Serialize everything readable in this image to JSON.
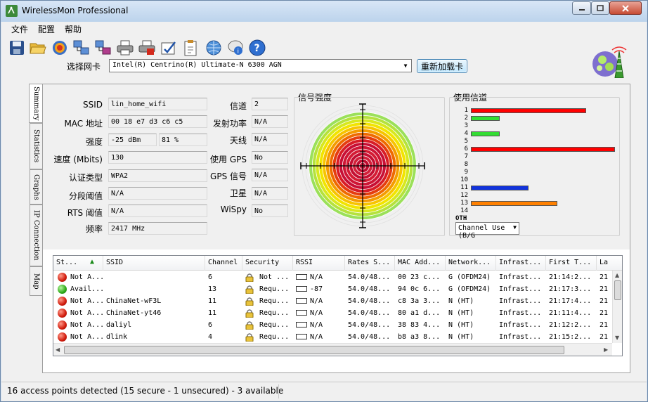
{
  "window": {
    "title": "WirelessMon Professional"
  },
  "menu": [
    "文件",
    "配置",
    "帮助"
  ],
  "toolbar": [
    "save-icon",
    "open-folder-icon",
    "record-icon",
    "network-connect-icon",
    "network-disconnect-icon",
    "print-icon",
    "print-stop-icon",
    "checklist-icon",
    "clipboard-icon",
    "globe-network-icon",
    "chat-info-icon",
    "help-icon"
  ],
  "adapter": {
    "label": "选择网卡",
    "value": "Intel(R) Centrino(R) Ultimate-N 6300 AGN",
    "reload_label": "重新加载卡"
  },
  "tabs": [
    "Summary",
    "Statistics",
    "Graphs",
    "IP Connection",
    "Map"
  ],
  "summary": {
    "ssid_label": "SSID",
    "ssid": "lin_home_wifi",
    "mac_label": "MAC 地址",
    "mac": "00 18 e7 d3 c6 c5",
    "strength_label": "强度",
    "strength_dbm": "-25 dBm",
    "strength_pct": "81 %",
    "speed_label": "速度 (Mbits)",
    "speed": "130",
    "auth_label": "认证类型",
    "auth": "WPA2",
    "frag_label": "分段阈值",
    "frag": "N/A",
    "rts_label": "RTS 阈值",
    "rts": "N/A",
    "freq_label": "频率",
    "freq": "2417 MHz",
    "channel_label": "信道",
    "channel": "2",
    "txpower_label": "发射功率",
    "txpower": "N/A",
    "antenna_label": "天线",
    "antenna": "N/A",
    "gps_use_label": "使用 GPS",
    "gps_use": "No",
    "gps_signal_label": "GPS 信号",
    "gps_signal": "N/A",
    "satellite_label": "卫星",
    "satellite": "N/A",
    "wispy_label": "WiSpy",
    "wispy": "No"
  },
  "signal": {
    "title": "信号强度",
    "rings": [
      "#f0f0f0",
      "#f0f0f0",
      "#9be05a",
      "#b5e23c",
      "#d7e81e",
      "#f2e400",
      "#f7c400",
      "#f49c00",
      "#ee6a00",
      "#e53d0f",
      "#d81c26",
      "#c70f35",
      "#ce1635",
      "#d41c34",
      "#c30f32",
      "#d2203a",
      "#bf0d30",
      "#c8193a"
    ]
  },
  "channel_use": {
    "title": "使用信道",
    "channels": [
      "1",
      "2",
      "3",
      "4",
      "5",
      "6",
      "7",
      "8",
      "9",
      "10",
      "11",
      "12",
      "13",
      "14",
      "OTH"
    ],
    "values": [
      16,
      4,
      0,
      4,
      0,
      20,
      0,
      0,
      0,
      0,
      8,
      0,
      12,
      0,
      0
    ],
    "max": 20,
    "colors": [
      "#ff0000",
      "#33dd33",
      "#ffffff",
      "#33dd33",
      "#ffffff",
      "#ff0000",
      "#ffffff",
      "#ffffff",
      "#ffffff",
      "#ffffff",
      "#1133dd",
      "#ffffff",
      "#ff8000",
      "#ffffff",
      "#ffffff"
    ],
    "select_value": "Channel Use (B/G"
  },
  "table": {
    "headers": [
      "St...",
      "SSID",
      "Channel",
      "Security",
      "RSSI",
      "Rates S...",
      "MAC Add...",
      "Network...",
      "Infrast...",
      "First T...",
      "La"
    ],
    "rows": [
      {
        "status": "red",
        "st": "Not A...",
        "ssid": "",
        "channel": "6",
        "security": "Not ...",
        "rssi": "N/A",
        "rates": "54.0/48...",
        "mac": "00 23 c...",
        "network": "G (OFDM24)",
        "infra": "Infrast...",
        "first": "21:14:2...",
        "last": "21"
      },
      {
        "status": "green",
        "st": "Avail...",
        "ssid": "",
        "channel": "13",
        "security": "Requ...",
        "rssi": "-87",
        "rates": "54.0/48...",
        "mac": "94 0c 6...",
        "network": "G (OFDM24)",
        "infra": "Infrast...",
        "first": "21:17:3...",
        "last": "21"
      },
      {
        "status": "red",
        "st": "Not A...",
        "ssid": "ChinaNet-wF3L",
        "channel": "11",
        "security": "Requ...",
        "rssi": "N/A",
        "rates": "54.0/48...",
        "mac": "c8 3a 3...",
        "network": "N (HT)",
        "infra": "Infrast...",
        "first": "21:17:4...",
        "last": "21"
      },
      {
        "status": "red",
        "st": "Not A...",
        "ssid": "ChinaNet-yt46",
        "channel": "11",
        "security": "Requ...",
        "rssi": "N/A",
        "rates": "54.0/48...",
        "mac": "80 a1 d...",
        "network": "N (HT)",
        "infra": "Infrast...",
        "first": "21:11:4...",
        "last": "21"
      },
      {
        "status": "red",
        "st": "Not A...",
        "ssid": "daliyl",
        "channel": "6",
        "security": "Requ...",
        "rssi": "N/A",
        "rates": "54.0/48...",
        "mac": "38 83 4...",
        "network": "N (HT)",
        "infra": "Infrast...",
        "first": "21:12:2...",
        "last": "21"
      },
      {
        "status": "red",
        "st": "Not A...",
        "ssid": "dlink",
        "channel": "4",
        "security": "Requ...",
        "rssi": "N/A",
        "rates": "54.0/48...",
        "mac": "b8 a3 8...",
        "network": "N (HT)",
        "infra": "Infrast...",
        "first": "21:15:2...",
        "last": "21"
      }
    ]
  },
  "status": {
    "text": "16 access points detected (15 secure - 1 unsecured) - 3 available"
  }
}
